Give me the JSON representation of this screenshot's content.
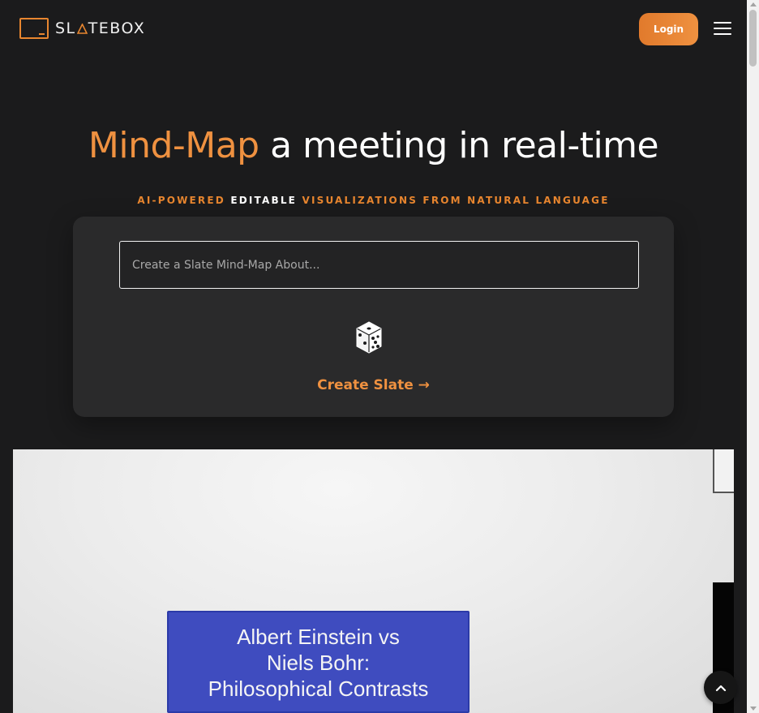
{
  "header": {
    "logo_pre": "SL",
    "logo_post": "TEBOX",
    "login_label": "Login",
    "menu_icon": "hamburger-menu-icon"
  },
  "hero": {
    "title_accent": "Mind-Map",
    "title_rest": " a meeting in real-time",
    "subtitle_part1": "AI-POWERED",
    "subtitle_part2": "EDITABLE",
    "subtitle_part3": "VISUALIZATIONS FROM NATURAL LANGUAGE"
  },
  "creator": {
    "input_placeholder": "Create a Slate Mind-Map About...",
    "input_value": "",
    "random_icon": "dice-icon",
    "create_label": "Create Slate →"
  },
  "preview": {
    "node_line1": "Albert Einstein vs",
    "node_line2": "Niels Bohr:",
    "node_line3": "Philosophical Contrasts"
  },
  "colors": {
    "accent": "#e8862f",
    "background": "#1b1b1c",
    "card": "#2a2a2b",
    "node": "#3f4cbf"
  }
}
